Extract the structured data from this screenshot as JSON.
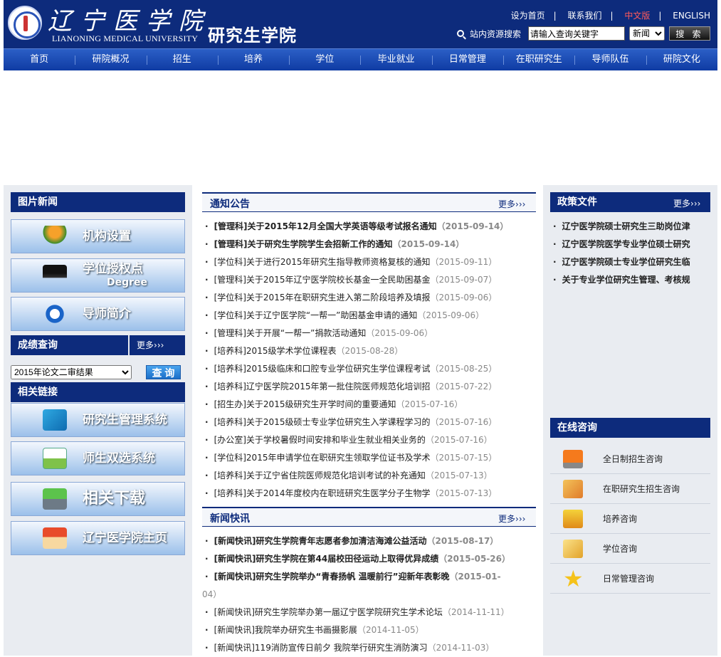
{
  "header": {
    "logo_cn": "辽宁医学院",
    "logo_en": "LIANONING MEDICAL UNIVERSITY",
    "site_title": "研究生学院"
  },
  "toplinks": {
    "home": "设为首页",
    "contact": "联系我们",
    "chinese": "中文版",
    "english": "ENGLISH"
  },
  "search": {
    "label": "站内资源搜索",
    "placeholder": "请输入查询关键字",
    "select": "新闻",
    "button": "搜 索"
  },
  "nav": [
    "首页",
    "研院概况",
    "招生",
    "培养",
    "学位",
    "毕业就业",
    "日常管理",
    "在职研究生",
    "导师队伍",
    "研院文化"
  ],
  "left": {
    "photo_news": "图片新闻",
    "banners": [
      "机构设置",
      "学位授权点",
      "导师简介"
    ],
    "banner_sub": "Degree",
    "grades_title": "成绩查询",
    "more": "更多",
    "grades_select": "2015年论文二审结果",
    "grades_btn": "查 询",
    "links_title": "相关链接",
    "link_banners": [
      "研究生管理系统",
      "师生双选系统",
      "相关下载",
      "辽宁医学院主页"
    ]
  },
  "notice": {
    "title": "通知公告",
    "more": "更多",
    "items": [
      {
        "text": "[管理科]关于2015年12月全国大学英语等级考试报名通知",
        "date": "（2015-09-14）",
        "bold": true
      },
      {
        "text": "[管理科]关于研究生学院学生会招新工作的通知",
        "date": "（2015-09-14）",
        "bold": true
      },
      {
        "text": "[学位科]关于进行2015年研究生指导教师资格复核的通知",
        "date": "（2015-09-11）"
      },
      {
        "text": "[管理科]关于2015年辽宁医学院校长基金一全民助困基金",
        "date": "（2015-09-07）"
      },
      {
        "text": "[学位科]关于2015年在职研究生进入第二阶段培养及填报",
        "date": "（2015-09-06）"
      },
      {
        "text": "[学位科]关于辽宁医学院“一帮一”助困基金申请的通知",
        "date": "（2015-09-06）"
      },
      {
        "text": "[管理科]关于开展“一帮一”捐款活动通知",
        "date": "（2015-09-06）"
      },
      {
        "text": "[培养科]2015级学术学位课程表",
        "date": "（2015-08-28）"
      },
      {
        "text": "[培养科]2015级临床和口腔专业学位研究生学位课程考试",
        "date": "（2015-08-25）"
      },
      {
        "text": "[培养科]辽宁医学院2015年第一批住院医师规范化培训招",
        "date": "（2015-07-22）"
      },
      {
        "text": "[招生办]关于2015级研究生开学时间的重要通知",
        "date": "（2015-07-16）"
      },
      {
        "text": "[培养科]关于2015级硕士专业学位研究生入学课程学习的",
        "date": "（2015-07-16）"
      },
      {
        "text": "[办公室]关于学校暑假时间安排和毕业生就业相关业务的",
        "date": "（2015-07-16）"
      },
      {
        "text": "[学位科]2015年申请学位在职研究生领取学位证书及学术",
        "date": "（2015-07-15）"
      },
      {
        "text": "[培养科]关于辽宁省住院医师规范化培训考试的补充通知",
        "date": "（2015-07-13）"
      },
      {
        "text": "[培养科]关于2014年度校内在职班研究生医学分子生物学",
        "date": "（2015-07-13）"
      }
    ]
  },
  "news": {
    "title": "新闻快讯",
    "more": "更多",
    "items": [
      {
        "text": "[新闻快讯]研究生学院青年志愿者参加清洁海滩公益活动",
        "date": "（2015-08-17）",
        "bold": true
      },
      {
        "text": "[新闻快讯]研究生学院在第44届校田径运动上取得优异成绩",
        "date": "（2015-05-26）",
        "bold": true
      },
      {
        "text": "[新闻快讯]研究生学院举办“青春扬帆 温暖前行”迎新年表彰晚",
        "date": "（2015-01-",
        "bold": true
      },
      {
        "text": "[新闻快讯]研究生学院举办第一届辽宁医学院研究生学术论坛",
        "date": "（2014-11-11）"
      },
      {
        "text": "[新闻快讯]我院举办研究生书画摄影展",
        "date": "（2014-11-05）"
      },
      {
        "text": "[新闻快讯]119消防宣传日前夕 我院举行研究生消防演习",
        "date": "（2014-11-03）"
      }
    ],
    "wrap": "04）"
  },
  "policy": {
    "title": "政策文件",
    "more": "更多",
    "items": [
      "辽宁医学院硕士研究生三助岗位津",
      "辽宁医学院医学专业学位硕士研究",
      "辽宁医学院硕士专业学位研究生临",
      "关于专业学位研究生管理、考核规"
    ]
  },
  "consult": {
    "title": "在线咨询",
    "items": [
      "全日制招生咨询",
      "在职研究生招生咨询",
      "培养咨询",
      "学位咨询",
      "日常管理咨询"
    ]
  }
}
